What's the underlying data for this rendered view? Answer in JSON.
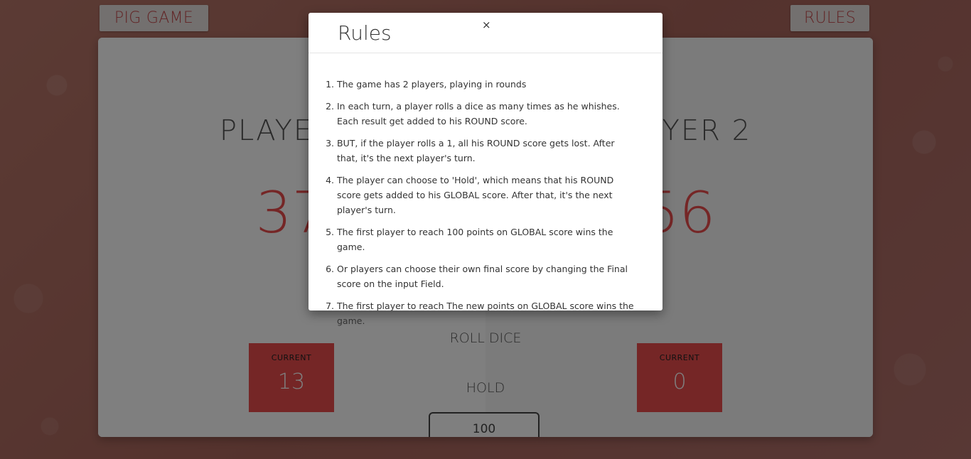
{
  "nav": {
    "brand": "PIG GAME",
    "rules_button": "RULES"
  },
  "players": [
    {
      "name": "PLAYER 1",
      "score": "37",
      "current_label": "CURRENT",
      "current": "13"
    },
    {
      "name": "PLAYER 2",
      "score": "56",
      "current_label": "CURRENT",
      "current": "0"
    }
  ],
  "controls": {
    "roll": "ROLL DICE",
    "hold": "HOLD",
    "final_score": "100"
  },
  "modal": {
    "title": "Rules",
    "close": "×",
    "rules": [
      "The game has 2 players, playing in rounds",
      "In each turn, a player rolls a dice as many times as he whishes. Each result get added to his ROUND score.",
      "BUT, if the player rolls a 1, all his ROUND score gets lost. After that, it's the next player's turn.",
      "The player can choose to 'Hold', which means that his ROUND score gets added to his GLOBAL score. After that, it's the next player's turn.",
      "The first player to reach 100 points on GLOBAL score wins the game.",
      "Or players can choose their own final score by changing the Final score on the input Field.",
      "The first player to reach The new points on GLOBAL score wins the game."
    ]
  },
  "colors": {
    "accent": "#eb4d4d",
    "background": "#a9695f"
  }
}
